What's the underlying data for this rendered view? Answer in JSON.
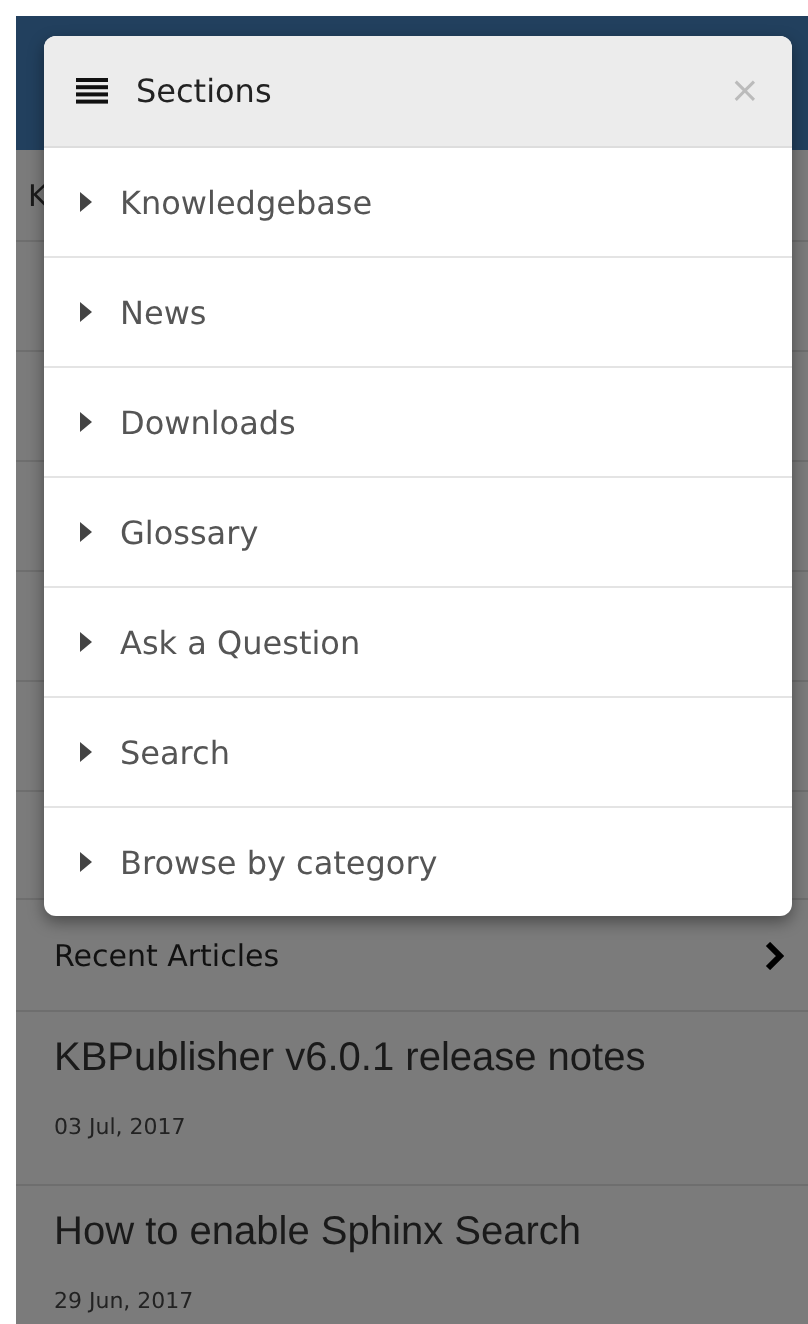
{
  "page": {
    "breadcrumb": "K",
    "recent": {
      "title": "Recent Articles"
    },
    "articles": [
      {
        "title": "KBPublisher v6.0.1 release notes",
        "date": "03 Jul, 2017"
      },
      {
        "title": "How to enable Sphinx Search",
        "date": "29 Jun, 2017"
      }
    ]
  },
  "modal": {
    "title": "Sections",
    "close": "×",
    "items": [
      {
        "label": "Knowledgebase"
      },
      {
        "label": "News"
      },
      {
        "label": "Downloads"
      },
      {
        "label": "Glossary"
      },
      {
        "label": "Ask a Question"
      },
      {
        "label": "Search"
      },
      {
        "label": "Browse by category"
      }
    ]
  }
}
